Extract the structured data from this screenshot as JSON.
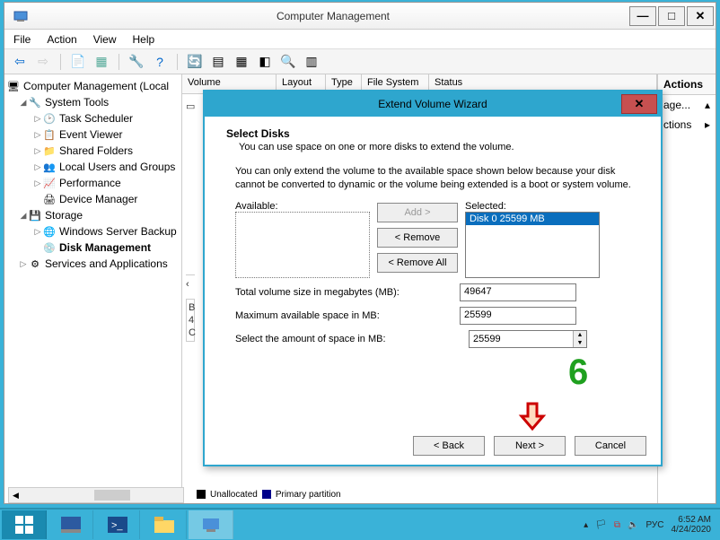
{
  "window": {
    "title": "Computer Management"
  },
  "menubar": [
    "File",
    "Action",
    "View",
    "Help"
  ],
  "tree": {
    "root": "Computer Management (Local",
    "system_tools": "System Tools",
    "task_scheduler": "Task Scheduler",
    "event_viewer": "Event Viewer",
    "shared_folders": "Shared Folders",
    "local_users": "Local Users and Groups",
    "performance": "Performance",
    "device_manager": "Device Manager",
    "storage": "Storage",
    "wsb": "Windows Server Backup",
    "disk_mgmt": "Disk Management",
    "services": "Services and Applications"
  },
  "columns": {
    "volume": "Volume",
    "layout": "Layout",
    "type": "Type",
    "fs": "File System",
    "status": "Status"
  },
  "actions": {
    "title": "Actions",
    "manage": "age...",
    "more": "ctions"
  },
  "bottom": {
    "unalloc": "Unallocated",
    "primary": "Primary partition",
    "b": "B",
    "four": "4",
    "c": "C"
  },
  "wizard": {
    "title": "Extend Volume Wizard",
    "heading": "Select Disks",
    "subheading": "You can use space on one or more disks to extend the volume.",
    "info": "You can only extend the volume to the available space shown below because your disk cannot be converted to dynamic or the volume being extended is a boot or system volume.",
    "available_label": "Available:",
    "selected_label": "Selected:",
    "selected_item": "Disk 0     25599 MB",
    "add": "Add >",
    "remove": "< Remove",
    "remove_all": "< Remove All",
    "total_label": "Total volume size in megabytes (MB):",
    "total_value": "49647",
    "max_label": "Maximum available space in MB:",
    "max_value": "25599",
    "select_label": "Select the amount of space in MB:",
    "select_value": "25599",
    "back": "< Back",
    "next": "Next >",
    "cancel": "Cancel"
  },
  "annotation": {
    "step": "6"
  },
  "tray": {
    "lang": "РУС",
    "time": "6:52 AM",
    "date": "4/24/2020"
  }
}
